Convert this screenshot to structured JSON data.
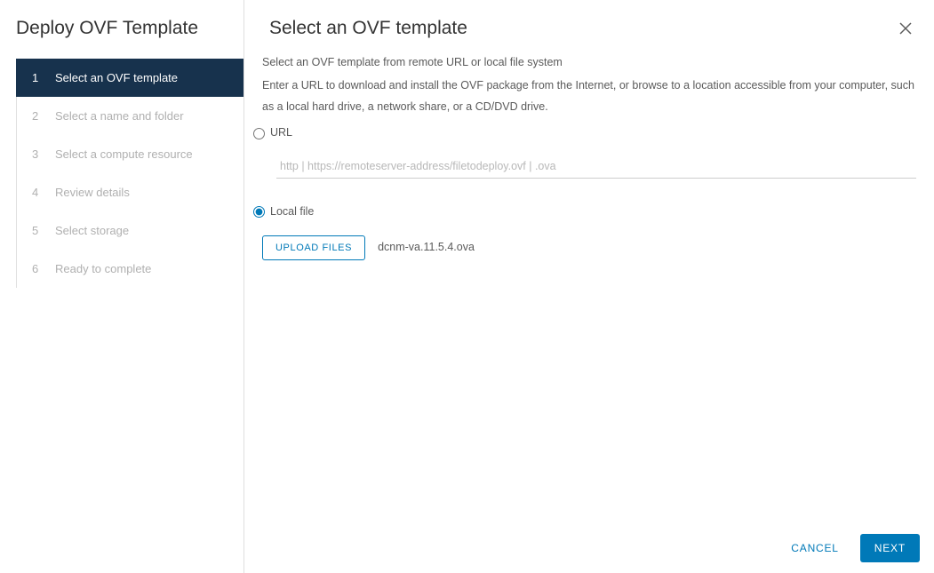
{
  "sidebar": {
    "title": "Deploy OVF Template",
    "steps": [
      {
        "number": "1",
        "label": "Select an OVF template",
        "active": true
      },
      {
        "number": "2",
        "label": "Select a name and folder",
        "active": false
      },
      {
        "number": "3",
        "label": "Select a compute resource",
        "active": false
      },
      {
        "number": "4",
        "label": "Review details",
        "active": false
      },
      {
        "number": "5",
        "label": "Select storage",
        "active": false
      },
      {
        "number": "6",
        "label": "Ready to complete",
        "active": false
      }
    ]
  },
  "main": {
    "title": "Select an OVF template",
    "subtitle": "Select an OVF template from remote URL or local file system",
    "description": "Enter a URL to download and install the OVF package from the Internet, or browse to a location accessible from your computer, such as a local hard drive, a network share, or a CD/DVD drive.",
    "url_option": {
      "label": "URL",
      "placeholder": "http | https://remoteserver-address/filetodeploy.ovf | .ova",
      "value": "",
      "selected": false
    },
    "local_option": {
      "label": "Local file",
      "upload_button": "UPLOAD FILES",
      "file_name": "dcnm-va.11.5.4.ova",
      "selected": true
    }
  },
  "footer": {
    "cancel": "CANCEL",
    "next": "NEXT"
  }
}
